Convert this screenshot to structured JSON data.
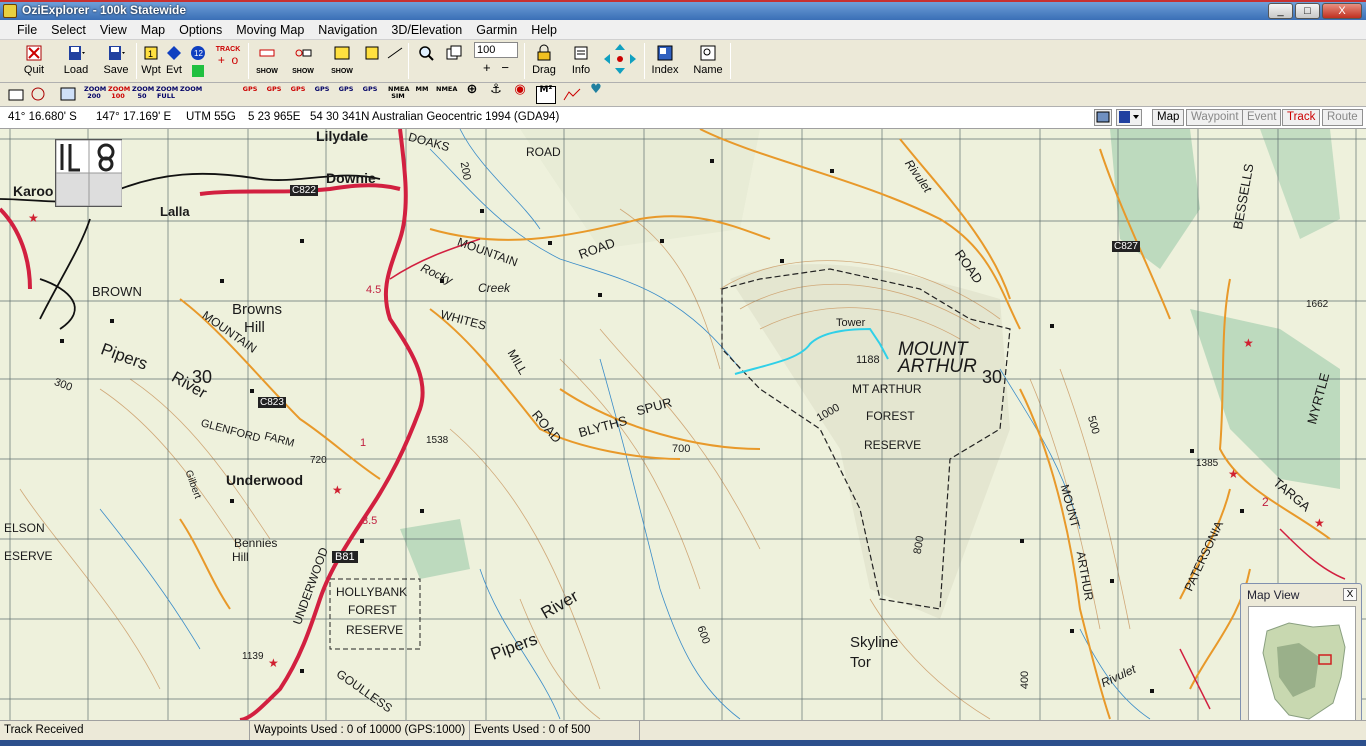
{
  "window": {
    "title": "OziExplorer - 100k Statewide",
    "controls": [
      "_",
      "□",
      "X"
    ]
  },
  "menu": [
    "File",
    "Select",
    "View",
    "Map",
    "Options",
    "Moving Map",
    "Navigation",
    "3D/Elevation",
    "Garmin",
    "Help"
  ],
  "toolbar": {
    "quit": "Quit",
    "load": "Load",
    "save": "Save",
    "wpt": "Wpt",
    "evt": "Evt",
    "track": "TRACK",
    "show": "SHOW",
    "zoom_value": "100",
    "drag": "Drag",
    "info": "Info",
    "index": "Index",
    "name": "Name"
  },
  "toolbar2": {
    "zoom200": "ZOOM 200",
    "zoom100": "ZOOM 100",
    "zoom50": "ZOOM 50",
    "zoomfull": "ZOOM FULL",
    "zoomx": "ZOOM",
    "nmea_sim": "NMEA SIM",
    "mm": "MM",
    "nmea": "NMEA",
    "m2": "M²",
    "gps1": "GPS",
    "gps2": "GPS",
    "gps3": "GPS",
    "gps4": "GPS",
    "gps5": "GPS",
    "gps6": "GPS"
  },
  "position": {
    "lat": "41° 16.680' S",
    "lon": "147° 17.169' E",
    "utm": "UTM  55G",
    "easting": "5 23 965E",
    "northing": "54 30 341N",
    "datum": "Australian Geocentric 1994 (GDA94)",
    "tabs": [
      "Map",
      "Waypoint",
      "Event",
      "Track",
      "Route"
    ]
  },
  "map_labels": {
    "lilydale": "Lilydale",
    "downie": "Downie",
    "karoo": "Karoo",
    "lalla": "Lalla",
    "brown": "BROWN",
    "browns_hill": "Browns\nHill",
    "pipers": "Pipers",
    "river": "River",
    "mountain_road": "MOUNTAIN",
    "c823": "C823",
    "c822": "C822",
    "c827": "C827",
    "b81": "B81",
    "underwood_town": "Underwood",
    "underwood_road": "UNDERWOOD",
    "bennies": "Bennies",
    "bennies_hill": "Hill",
    "hollybank1": "HOLLYBANK",
    "hollybank2": "FOREST",
    "hollybank3": "RESERVE",
    "mount_arthur1": "MOUNT",
    "mount_arthur2": "ARTHUR",
    "tower": "Tower",
    "h1188": "1188",
    "mt_arthur_fr1": "MT ARTHUR",
    "mt_arthur_fr2": "FOREST",
    "mt_arthur_fr3": "RESERVE",
    "blyths": "BLYTHS",
    "spur": "SPUR",
    "skyline": "Skyline",
    "tor": "Tor",
    "rocky": "Rocky",
    "creek": "Creek",
    "whites": "WHITES",
    "mill": "MILL",
    "doaks": "DOAKS",
    "road": "ROAD",
    "bessells": "BESSELLS",
    "myrtle": "MYRTLE",
    "targa": "TARGA",
    "paternoster": "PATERSONIA",
    "rivulet": "Rivulet",
    "glenford": "GLENFORD",
    "farm": "FARM",
    "goulless": "GOULLESS",
    "gilbert": "Gilbert",
    "elson": "ELSON",
    "eserve": "ESERVE",
    "grid30a": "30",
    "grid30b": "30",
    "h700": "700",
    "h1000": "1000",
    "h800": "800",
    "h500": "500",
    "h400": "400",
    "h600": "600",
    "h300": "300",
    "h200": "200",
    "h720": "720",
    "h1538": "1538",
    "h1385": "1385",
    "h1139": "1139",
    "h1662": "1662",
    "h4_5": "4.5",
    "h3_5": "3.5",
    "h1": "1",
    "h2": "2"
  },
  "map_view": {
    "title": "Map View",
    "close": "X"
  },
  "status": {
    "left": "Track Received",
    "waypoints": "Waypoints Used : 0 of 10000  (GPS:1000)",
    "events": "Events Used : 0 of 500"
  },
  "colors": {
    "titlebar": "#3a6fb6",
    "road_major": "#d0203a",
    "road_minor": "#e89a30",
    "contour": "#c8a070",
    "grid": "#505050",
    "forest": "#98c8a0",
    "water": "#4090c8",
    "track": "#30d0e8"
  }
}
